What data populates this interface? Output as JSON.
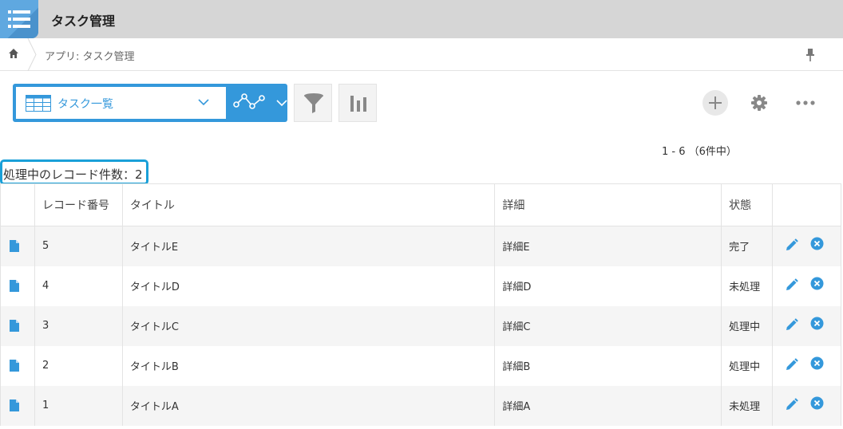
{
  "app": {
    "title": "タスク管理"
  },
  "breadcrumb": {
    "path": "アプリ: タスク管理"
  },
  "toolbar": {
    "view_label": "タスク一覧"
  },
  "pagination": {
    "text": "1 - 6 （6件中）"
  },
  "summary": {
    "processing_count_label": "処理中のレコード件数：2"
  },
  "table": {
    "columns": [
      "レコード番号",
      "タイトル",
      "詳細",
      "状態"
    ],
    "rows": [
      {
        "num": "5",
        "title": "タイトルE",
        "detail": "詳細E",
        "status": "完了"
      },
      {
        "num": "4",
        "title": "タイトルD",
        "detail": "詳細D",
        "status": "未処理"
      },
      {
        "num": "3",
        "title": "タイトルC",
        "detail": "詳細C",
        "status": "処理中"
      },
      {
        "num": "2",
        "title": "タイトルB",
        "detail": "詳細B",
        "status": "処理中"
      },
      {
        "num": "1",
        "title": "タイトルA",
        "detail": "詳細A",
        "status": "未処理"
      }
    ]
  },
  "colors": {
    "accent": "#3498db",
    "header_bar": "#d6d6d6",
    "highlight_border": "#1aa0d8"
  },
  "icons": {
    "app": "list-icon",
    "home": "home-icon",
    "pin": "pin-icon",
    "view": "table-icon",
    "graph": "graph-icon",
    "filter": "filter-icon",
    "chart": "bar-chart-icon",
    "add": "plus-icon",
    "settings": "gear-icon",
    "more": "more-icon",
    "row_detail": "document-icon",
    "edit": "pencil-icon",
    "delete": "close-circle-icon"
  }
}
